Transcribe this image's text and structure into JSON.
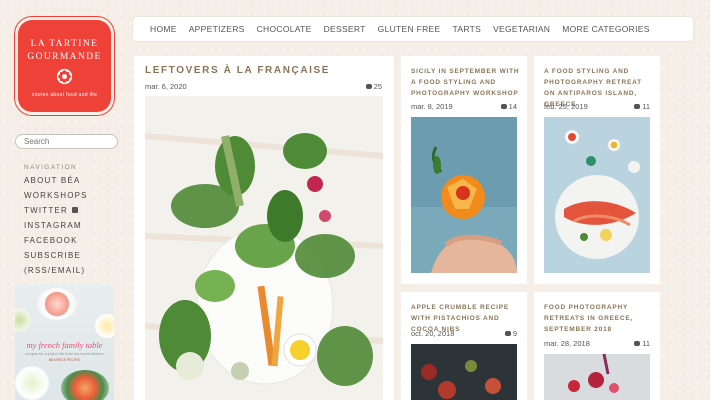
{
  "brand": {
    "line1": "LA TARTINE",
    "line2": "GOURMANDE",
    "tagline": "stories about food and life",
    "color": "#ee4138"
  },
  "search": {
    "placeholder": "Search"
  },
  "sidebar_nav": {
    "heading": "NAVIGATION",
    "items": [
      {
        "label": "ABOUT BÉA"
      },
      {
        "label": "WORKSHOPS"
      },
      {
        "label": "TWITTER",
        "icon": "twitter-icon"
      },
      {
        "label": "INSTAGRAM"
      },
      {
        "label": "FACEBOOK"
      },
      {
        "label": "SUBSCRIBE"
      },
      {
        "label": "(RSS/EMAIL)"
      }
    ]
  },
  "book": {
    "title": "my french family table",
    "subtitle": "recipes for a joyful life from my home kitchen",
    "author": "BEATRICE PELTRE"
  },
  "topnav": {
    "items": [
      "HOME",
      "APPETIZERS",
      "CHOCOLATE",
      "DESSERT",
      "GLUTEN FREE",
      "TARTS",
      "VEGETARIAN",
      "MORE CATEGORIES"
    ]
  },
  "posts": [
    {
      "title": "LEFTOVERS À LA FRANÇAISE",
      "date": "mar. 6, 2020",
      "comments": "25",
      "image": "vegetables-on-white-table"
    },
    {
      "title": "SICILY IN SEPTEMBER WITH A FOOD STYLING AND PHOTOGRAPHY WORKSHOP",
      "date": "mar. 8, 2019",
      "comments": "14",
      "image": "hand-holding-orange"
    },
    {
      "title": "A FOOD STYLING AND PHOTOGRAPHY RETREAT ON ANTIPAROS ISLAND, GREECE",
      "date": "feb. 25, 2019",
      "comments": "11",
      "image": "fish-plate-on-blue"
    },
    {
      "title": "APPLE CRUMBLE RECIPE WITH PISTACHIOS AND COCOA NIBS",
      "date": "oct. 20, 2018",
      "comments": "9",
      "image": "apples-dark"
    },
    {
      "title": "FOOD PHOTOGRAPHY RETREATS IN GREECE, SEPTEMBER 2018",
      "date": "mar. 28, 2018",
      "comments": "11",
      "image": "berries-table"
    }
  ],
  "colors": {
    "background": "#f4eee6",
    "accent": "#ee4138",
    "title": "#8a7458"
  }
}
